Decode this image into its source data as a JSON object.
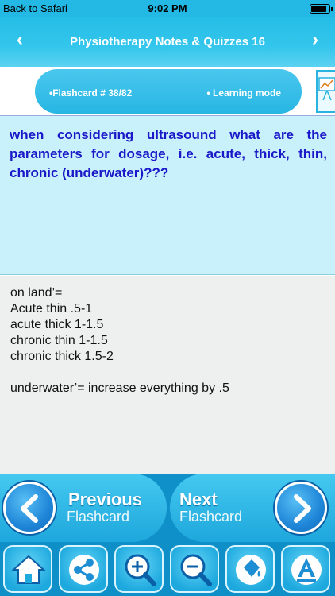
{
  "status_bar": {
    "back_label": "Back to Safari",
    "time": "9:02 PM",
    "battery_level": 0.9
  },
  "navbar": {
    "title": "Physiotherapy Notes & Quizzes 16",
    "prev_icon": "chevron-left-icon",
    "next_icon": "chevron-right-icon"
  },
  "info": {
    "flashcard_label": "•Flashcard #  38/82",
    "mode_label": "• Learning mode"
  },
  "question": {
    "text": "when considering ultrasound what are the parameters for dosage, i.e. acute, thick, thin, chronic (underwater)???"
  },
  "answer": {
    "lines": [
      "on land’=",
      "Acute thin .5-1",
      "acute thick 1-1.5",
      "chronic thin 1-1.5",
      "chronic thick 1.5-2",
      "",
      "underwater’= increase everything by .5"
    ]
  },
  "buttons": {
    "prev_big": "Previous",
    "prev_small": "Flashcard",
    "next_big": "Next",
    "next_small": "Flashcard"
  },
  "toolbar": {
    "icons": [
      "home-icon",
      "share-icon",
      "zoom-in-icon",
      "zoom-out-icon",
      "paint-bucket-icon",
      "font-icon"
    ]
  },
  "colors": {
    "accent": "#23b9e4",
    "question_text": "#1a18c8",
    "question_bg": "#c9f1fb",
    "answer_bg": "#eef0f0",
    "toolbar_bg": "#0f8fc7"
  }
}
